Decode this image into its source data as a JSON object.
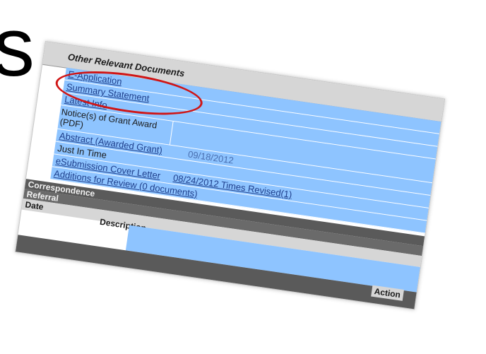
{
  "slide": {
    "big_letter": "s"
  },
  "section": {
    "title": "Other Relevant Documents"
  },
  "links": {
    "other_doc": "E-Application",
    "summary_statement": "Summary Statement",
    "latest_info": "Latest Info"
  },
  "grant": {
    "notice_label": "Notice(s) of Grant Award (PDF)",
    "abstract_link": "Abstract (Awarded Grant)",
    "abstract_date": "09/18/2012",
    "jit_label": "Just In Time",
    "esub_link": "eSubmission Cover Letter",
    "esub_date_link": "08/24/2012 Times Revised(1)",
    "additions_link": "Additions for Review (0 documents)"
  },
  "bars": {
    "correspondence": "Correspondence",
    "referral": "Referral"
  },
  "table": {
    "col_date": "Date",
    "col_description": "Description",
    "col_action": "Action"
  },
  "colors": {
    "row_blue": "#8ec4ff",
    "link_blue": "#1f3f8c",
    "highlight_red": "#d01515",
    "dark_bar": "#5a5a5a"
  }
}
